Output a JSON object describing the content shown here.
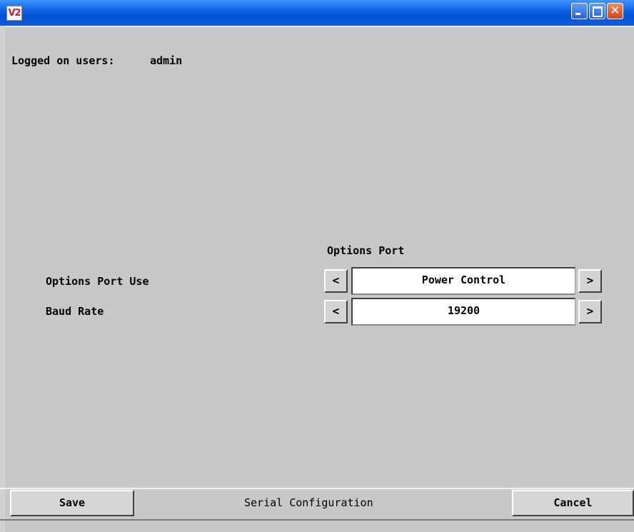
{
  "window": {
    "icon_text": "V2",
    "controls": {
      "minimize": "minimize",
      "maximize": "maximize",
      "close": "close"
    }
  },
  "status": {
    "logged_on_label": "Logged on users:",
    "logged_on_users": "admin"
  },
  "section": {
    "title": "Options Port"
  },
  "settings": [
    {
      "label": "Options Port Use",
      "value": "Power Control",
      "prev": "<",
      "next": ">"
    },
    {
      "label": "Baud Rate",
      "value": "19200",
      "prev": "<",
      "next": ">"
    }
  ],
  "footer": {
    "save_label": "Save",
    "page_title": "Serial Configuration",
    "cancel_label": "Cancel"
  },
  "colors": {
    "titlebar": "#0a5fe6",
    "background": "#c8c8c8",
    "close_button": "#d2431c"
  }
}
